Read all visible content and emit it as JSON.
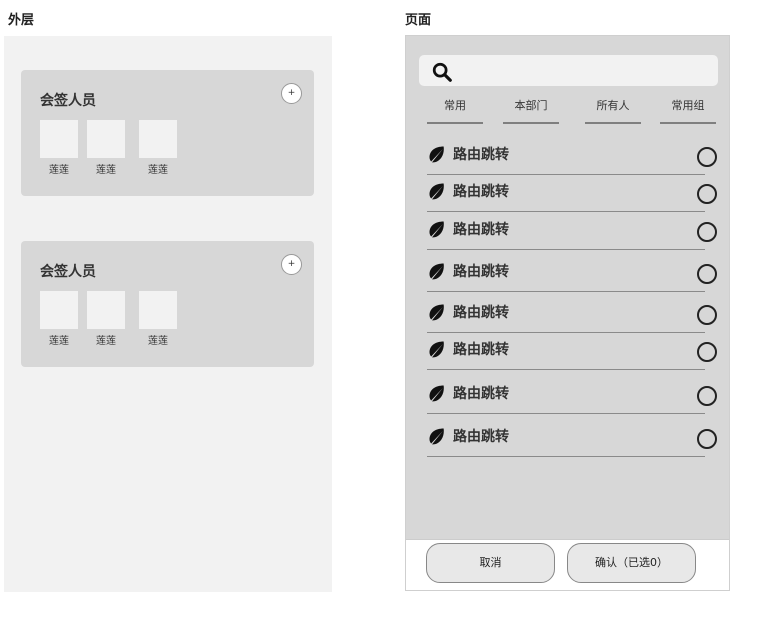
{
  "labels": {
    "outer": "外层",
    "page": "页面"
  },
  "outer": {
    "cards": [
      {
        "title": "会签人员",
        "add_symbol": "+",
        "members": [
          "莲莲",
          "莲莲",
          "莲莲"
        ]
      },
      {
        "title": "会签人员",
        "add_symbol": "+",
        "members": [
          "莲莲",
          "莲莲",
          "莲莲"
        ]
      }
    ]
  },
  "page": {
    "search": {
      "icon": "search-icon"
    },
    "tabs": [
      "常用",
      "本部门",
      "所有人",
      "常用组"
    ],
    "list": [
      {
        "label": "路由跳转",
        "icon": "leaf-icon"
      },
      {
        "label": "路由跳转",
        "icon": "leaf-icon"
      },
      {
        "label": "路由跳转",
        "icon": "leaf-icon"
      },
      {
        "label": "路由跳转",
        "icon": "leaf-icon"
      },
      {
        "label": "路由跳转",
        "icon": "leaf-icon"
      },
      {
        "label": "路由跳转",
        "icon": "leaf-icon"
      },
      {
        "label": "路由跳转",
        "icon": "leaf-icon"
      },
      {
        "label": "路由跳转",
        "icon": "leaf-icon"
      }
    ],
    "footer": {
      "cancel": "取消",
      "confirm": "确认（已选0）"
    }
  },
  "colors": {
    "panel": "#f2f2f2",
    "card": "#d7d7d7",
    "phone_bg": "#d7d7d7",
    "divider": "#8a8a8a"
  }
}
